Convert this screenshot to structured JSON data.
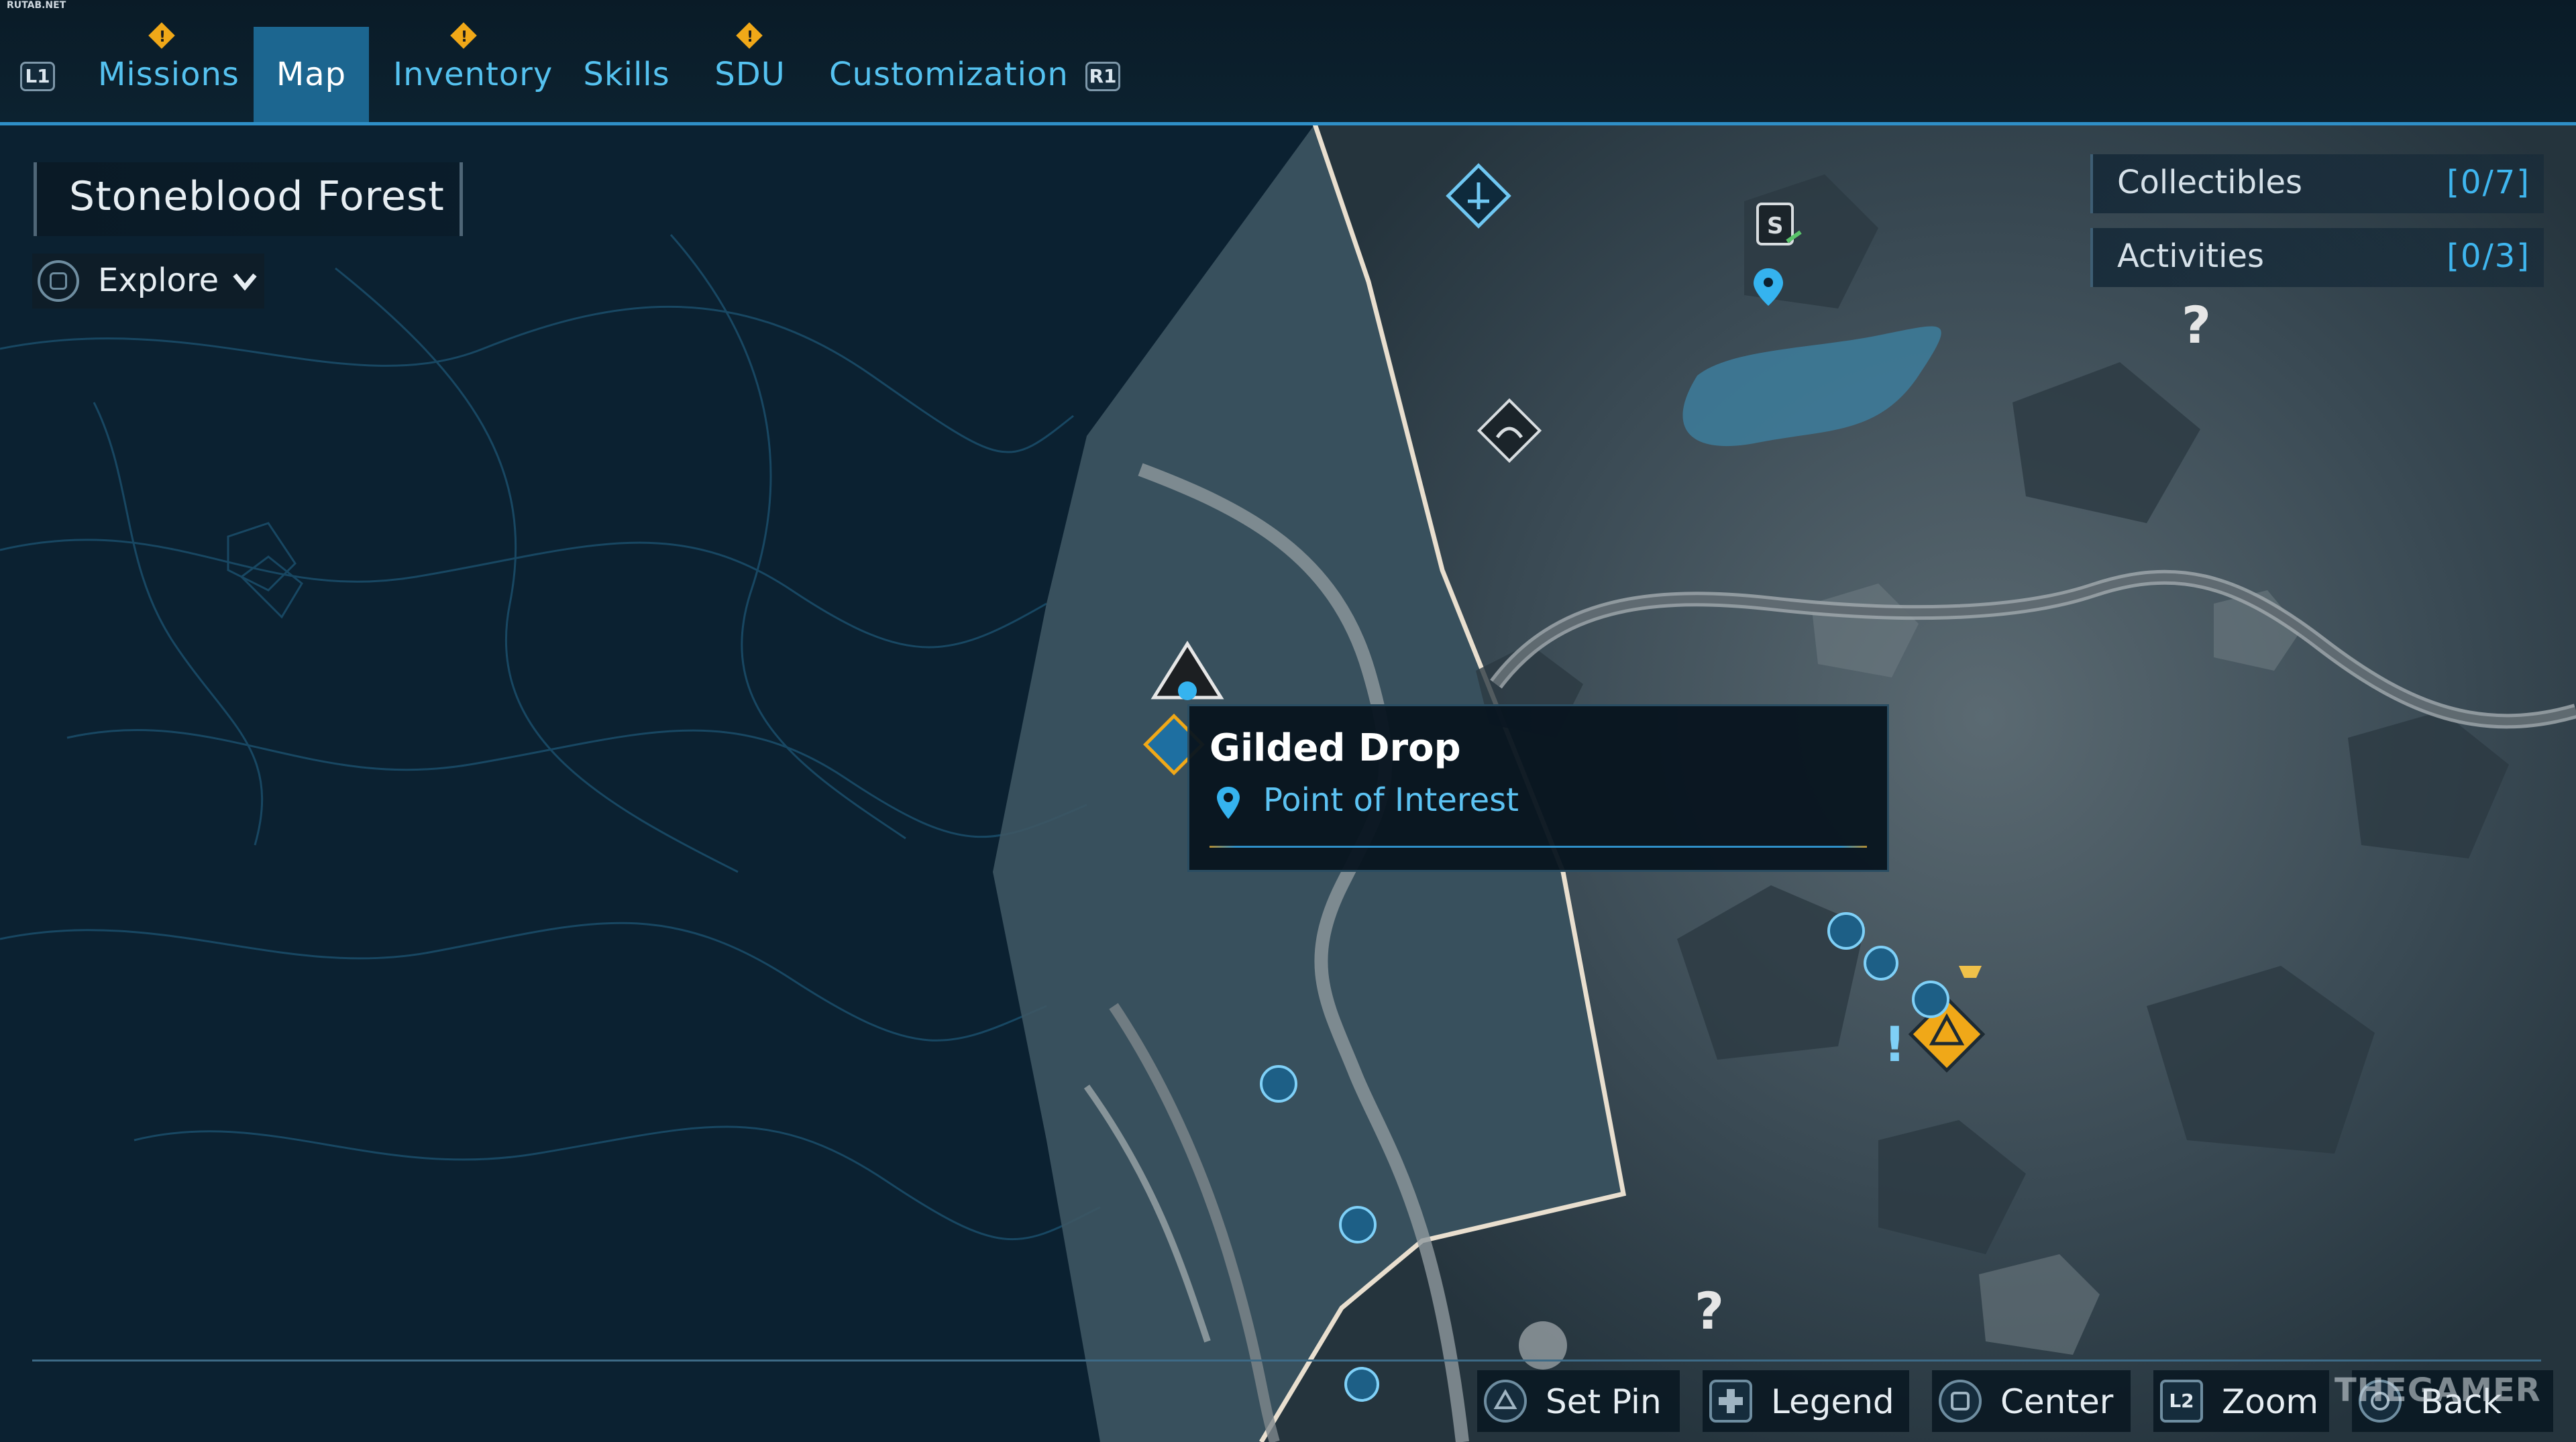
{
  "watermark_top": "RUTAB.NET",
  "nav": {
    "left_hint": "L1",
    "right_hint": "R1",
    "tabs": [
      {
        "label": "Missions",
        "alert": true
      },
      {
        "label": "Map",
        "alert": false,
        "active": true
      },
      {
        "label": "Inventory",
        "alert": true
      },
      {
        "label": "Skills",
        "alert": false
      },
      {
        "label": "SDU",
        "alert": true
      },
      {
        "label": "Customization",
        "alert": false
      }
    ]
  },
  "region": {
    "name": "Stoneblood Forest",
    "mode": "Explore"
  },
  "counters": [
    {
      "label": "Collectibles",
      "value": "[0/7]"
    },
    {
      "label": "Activities",
      "value": "[0/3]"
    }
  ],
  "tooltip": {
    "title": "Gilded Drop",
    "subtitle": "Point of Interest"
  },
  "unknown_marker": "?",
  "prompts": [
    {
      "key": "triangle",
      "label": "Set Pin"
    },
    {
      "key": "dpad",
      "label": "Legend"
    },
    {
      "key": "square",
      "label": "Center"
    },
    {
      "key": "L2",
      "label": "Zoom"
    },
    {
      "key": "circle",
      "label": "Back"
    }
  ],
  "watermark_bottom": "THEGAMER",
  "colors": {
    "accent": "#2f8fc7",
    "tab_text": "#55c2f0",
    "alert": "#f0a818",
    "counter_value": "#3fb6ef"
  }
}
